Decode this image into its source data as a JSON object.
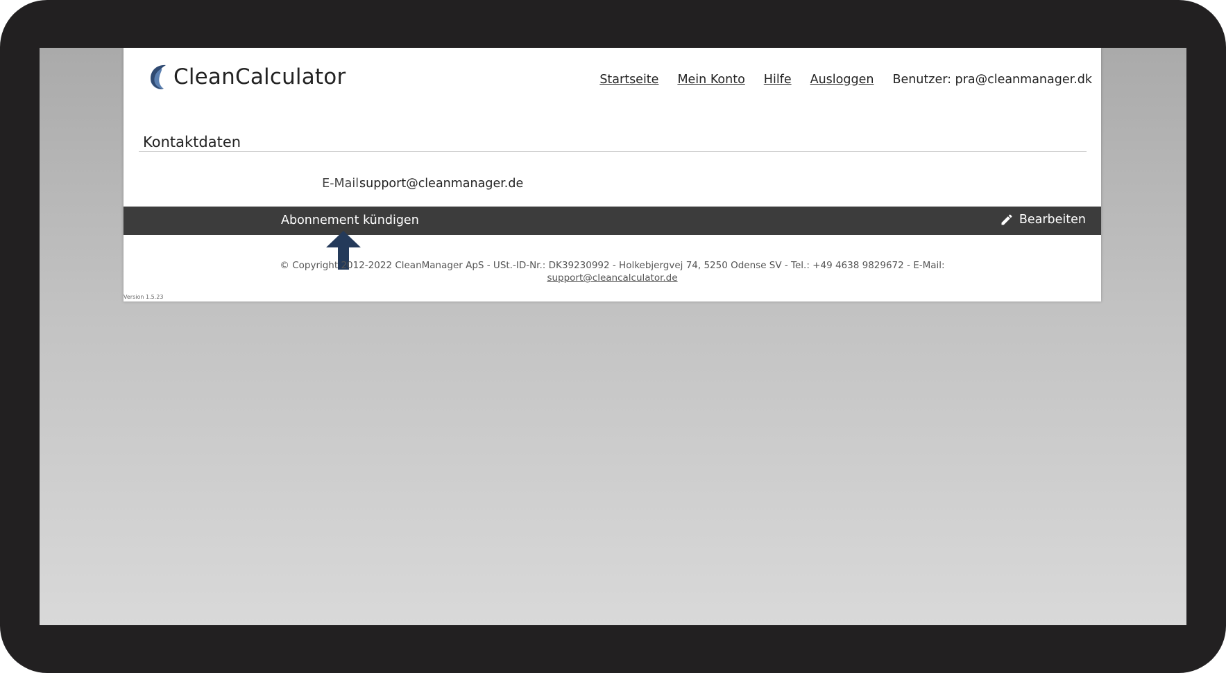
{
  "app": {
    "logo_text": "CleanCalculator"
  },
  "nav": {
    "items": [
      {
        "label": "Startseite"
      },
      {
        "label": "Mein Konto"
      },
      {
        "label": "Hilfe"
      },
      {
        "label": "Ausloggen"
      }
    ],
    "user_text": "Benutzer: pra@cleanmanager.dk"
  },
  "contact": {
    "title": "Kontaktdaten",
    "email_label": "E-Mail:",
    "email_value": "support@cleanmanager.de"
  },
  "actions": {
    "cancel_subscription": "Abonnement kündigen",
    "edit": "Bearbeiten",
    "edit_icon": "pencil-icon"
  },
  "footer": {
    "copyright": "© Copyright 2012-2022 CleanManager ApS - USt.-ID-Nr.: DK39230992 - Holkebjergvej 74, 5250 Odense SV - Tel.: +49 4638 9829672 - E-Mail:",
    "email_link": "support@cleancalculator.de",
    "version": "Version 1.5.23"
  },
  "colors": {
    "device_frame": "#222021",
    "action_bar": "#3c3c3c",
    "annotation_arrow": "#243a5a",
    "logo_primary": "#2f4a72"
  }
}
